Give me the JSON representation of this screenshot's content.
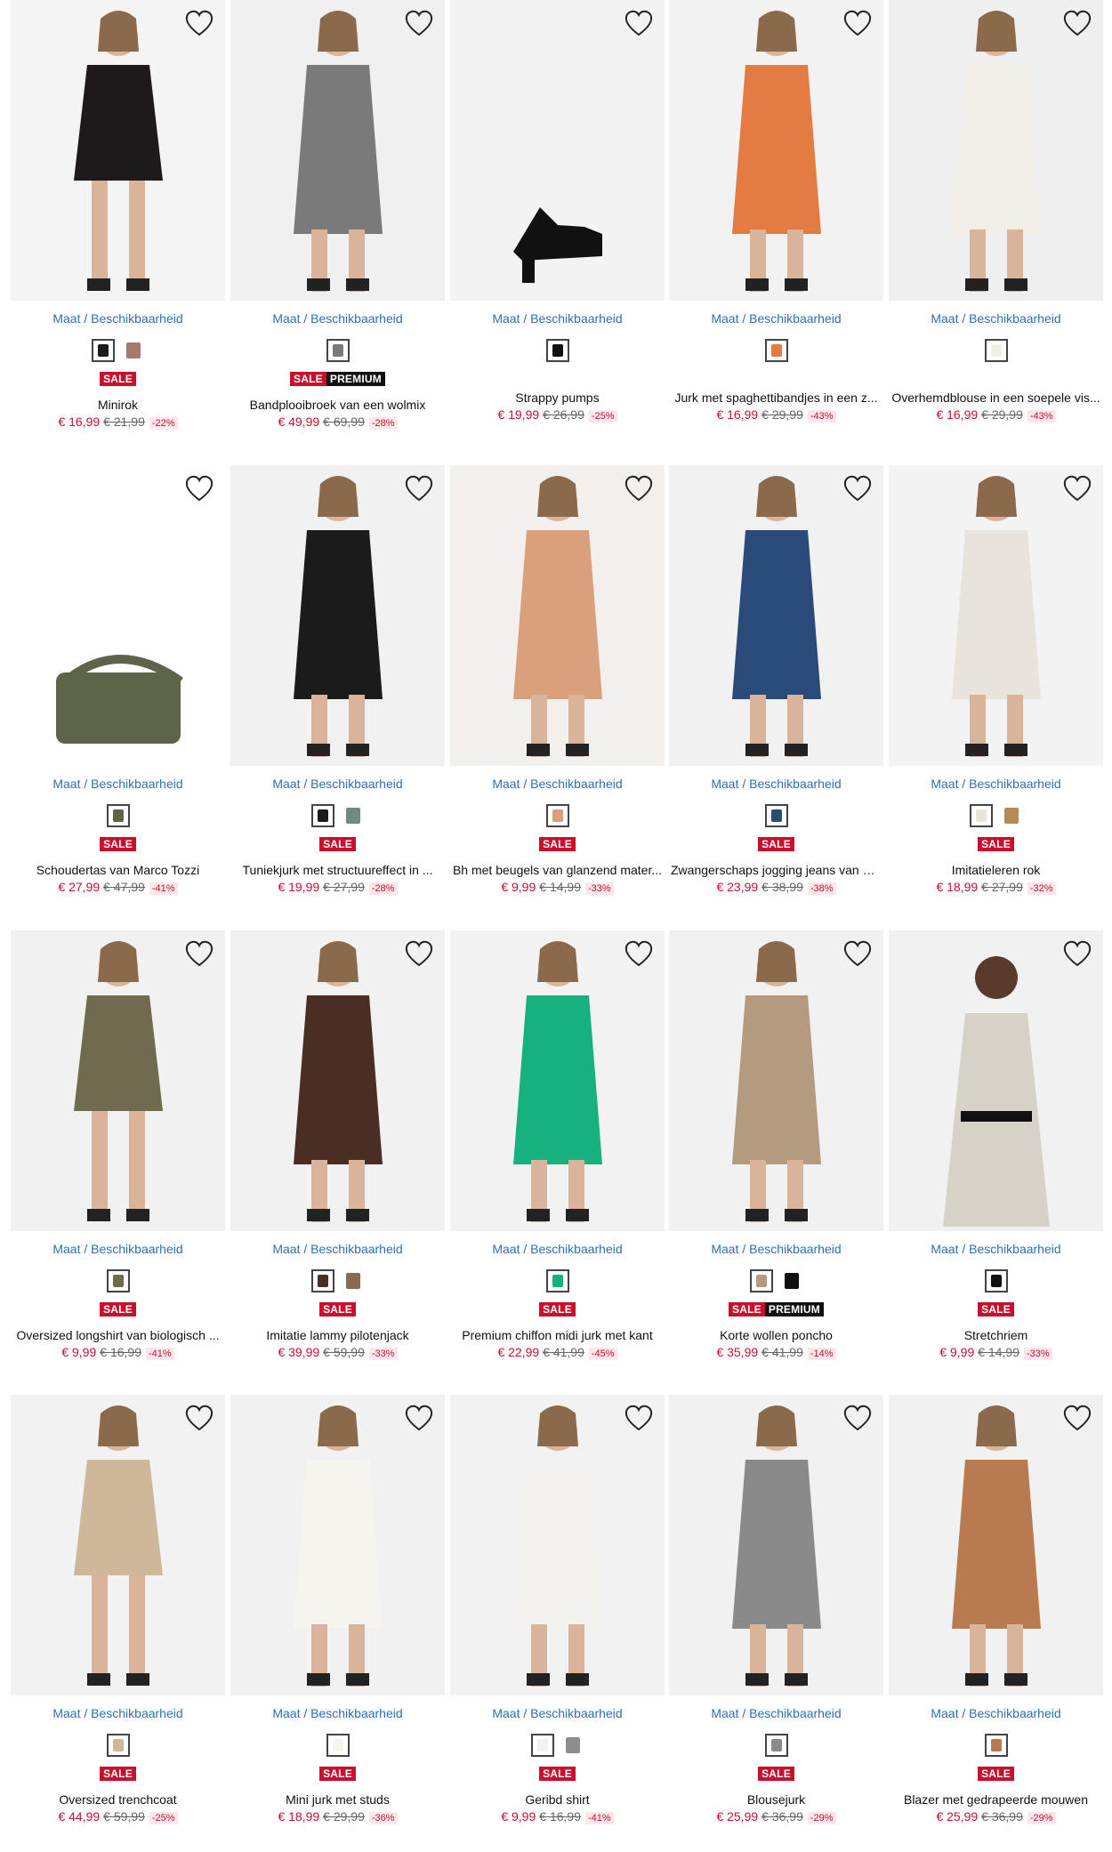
{
  "size_link": "Maat / Beschikbaarheid",
  "colors": {
    "sale": "#c8102e",
    "premium": "#111111",
    "link": "#2f6fb5"
  },
  "products": [
    {
      "name": "Minirok",
      "price": "€ 16,99",
      "old_price": "€ 21,99",
      "discount": "-22%",
      "badges": [
        "SALE"
      ],
      "bg": "#f4f4f4",
      "colors": [
        "#1e1a1c",
        "#a47a6e"
      ]
    },
    {
      "name": "Bandplooibroek van een wolmix",
      "price": "€ 49,99",
      "old_price": "€ 69,99",
      "discount": "-28%",
      "badges": [
        "SALE",
        "PREMIUM"
      ],
      "bg": "#f0f0f0",
      "colors": [
        "#7a7a7a"
      ]
    },
    {
      "name": "Strappy pumps",
      "price": "€ 19,99",
      "old_price": "€ 26,99",
      "discount": "-25%",
      "badges": [],
      "bg": "#f3f3f3",
      "colors": [
        "#111111"
      ]
    },
    {
      "name": "Jurk met spaghettibandjes in een z...",
      "price": "€ 16,99",
      "old_price": "€ 29,99",
      "discount": "-43%",
      "badges": [],
      "bg": "#f2f2f2",
      "colors": [
        "#e37b43"
      ]
    },
    {
      "name": "Overhemdblouse in een soepele vis...",
      "price": "€ 16,99",
      "old_price": "€ 29,99",
      "discount": "-43%",
      "badges": [],
      "bg": "#efefef",
      "colors": [
        "#f2efe8"
      ]
    },
    {
      "name": "Schoudertas van Marco Tozzi",
      "price": "€ 27,99",
      "old_price": "€ 47,99",
      "discount": "-41%",
      "badges": [
        "SALE"
      ],
      "bg": "#ffffff",
      "colors": [
        "#5e6447"
      ]
    },
    {
      "name": "Tuniekjurk met structuureffect in ...",
      "price": "€ 19,99",
      "old_price": "€ 27,99",
      "discount": "-28%",
      "badges": [
        "SALE"
      ],
      "bg": "#f1f1f1",
      "colors": [
        "#1b1b1b",
        "#6d8a83"
      ]
    },
    {
      "name": "Bh met beugels van glanzend mater...",
      "price": "€ 9,99",
      "old_price": "€ 14,99",
      "discount": "-33%",
      "badges": [
        "SALE"
      ],
      "bg": "#f2efec",
      "colors": [
        "#d9a07c"
      ]
    },
    {
      "name": "Zwangerschaps jogging jeans van bi...",
      "price": "€ 23,99",
      "old_price": "€ 38,99",
      "discount": "-38%",
      "badges": [
        "SALE"
      ],
      "bg": "#f1f1f1",
      "colors": [
        "#2a4a7a"
      ]
    },
    {
      "name": "Imitatieleren rok",
      "price": "€ 18,99",
      "old_price": "€ 27,99",
      "discount": "-32%",
      "badges": [
        "SALE"
      ],
      "bg": "#f3f3f3",
      "colors": [
        "#e8e4dc",
        "#b58a55"
      ]
    },
    {
      "name": "Oversized longshirt van biologisch ...",
      "price": "€ 9,99",
      "old_price": "€ 16,99",
      "discount": "-41%",
      "badges": [
        "SALE"
      ],
      "bg": "#f1f1f1",
      "colors": [
        "#6e6b4e"
      ]
    },
    {
      "name": "Imitatie lammy pilotenjack",
      "price": "€ 39,99",
      "old_price": "€ 59,99",
      "discount": "-33%",
      "badges": [
        "SALE"
      ],
      "bg": "#f1f1f1",
      "colors": [
        "#4a2e24",
        "#8a6a4e"
      ]
    },
    {
      "name": "Premium chiffon midi jurk met kant",
      "price": "€ 22,99",
      "old_price": "€ 41,99",
      "discount": "-45%",
      "badges": [
        "SALE"
      ],
      "bg": "#f2f2f2",
      "colors": [
        "#17b07f"
      ]
    },
    {
      "name": "Korte wollen poncho",
      "price": "€ 35,99",
      "old_price": "€ 41,99",
      "discount": "-14%",
      "badges": [
        "SALE",
        "PREMIUM"
      ],
      "bg": "#f1f1f1",
      "colors": [
        "#b49a7e",
        "#111111"
      ]
    },
    {
      "name": "Stretchriem",
      "price": "€ 9,99",
      "old_price": "€ 14,99",
      "discount": "-33%",
      "badges": [
        "SALE"
      ],
      "bg": "#f1f1f1",
      "colors": [
        "#111111"
      ]
    },
    {
      "name": "Oversized trenchcoat",
      "price": "€ 44,99",
      "old_price": "€ 59,99",
      "discount": "-25%",
      "badges": [
        "SALE"
      ],
      "bg": "#f2f2f2",
      "colors": [
        "#cdb99a"
      ]
    },
    {
      "name": "Mini jurk met studs",
      "price": "€ 18,99",
      "old_price": "€ 29,99",
      "discount": "-36%",
      "badges": [
        "SALE"
      ],
      "bg": "#f1f1f1",
      "colors": [
        "#f6f4ef"
      ]
    },
    {
      "name": "Geribd shirt",
      "price": "€ 9,99",
      "old_price": "€ 16,99",
      "discount": "-41%",
      "badges": [
        "SALE"
      ],
      "bg": "#f2f2f2",
      "colors": [
        "#f4f2ee",
        "#8d8d8d"
      ]
    },
    {
      "name": "Blousejurk",
      "price": "€ 25,99",
      "old_price": "€ 36,99",
      "discount": "-29%",
      "badges": [
        "SALE"
      ],
      "bg": "#f1f1f1",
      "colors": [
        "#8a8a8a"
      ]
    },
    {
      "name": "Blazer met gedrapeerde mouwen",
      "price": "€ 25,99",
      "old_price": "€ 36,99",
      "discount": "-29%",
      "badges": [
        "SALE"
      ],
      "bg": "#f1f1f1",
      "colors": [
        "#b87a4e"
      ]
    }
  ]
}
